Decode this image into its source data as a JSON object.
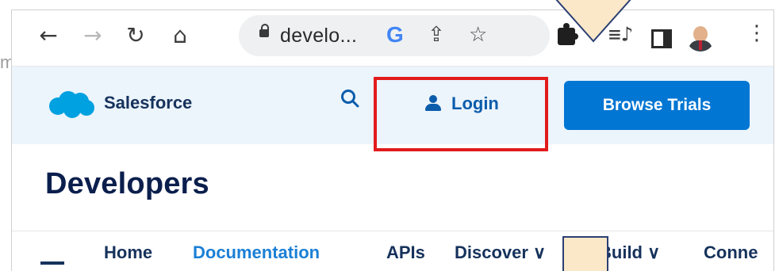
{
  "browser": {
    "back_icon": "arrow-left-icon",
    "forward_icon": "arrow-right-icon",
    "reload_icon": "reload-icon",
    "home_icon": "home-icon",
    "url": "develo...",
    "google_letter": "G",
    "share_icon": "share-icon",
    "bookmark_icon": "star-icon",
    "extensions_icon": "puzzle-icon",
    "media_icon": "media-queue-icon",
    "side_panel_icon": "side-panel-icon",
    "profile_icon": "avatar",
    "menu_icon": "kebab-menu-icon"
  },
  "stray_text": "m",
  "site": {
    "brand": "Salesforce",
    "login_label": "Login",
    "browse_trials_label": "Browse Trials",
    "page_title": "Developers",
    "nav": [
      "Home",
      "Documentation",
      "APIs",
      "Discover ∨",
      "Build ∨",
      "Conne"
    ],
    "active_nav": "Documentation"
  },
  "colors": {
    "header_bg": "#ecf4fc",
    "brand_blue": "#0176d3",
    "navy": "#16325c",
    "highlight_red": "#e21b1b",
    "callout_fill": "#fbe8c8",
    "callout_stroke": "#2b3f73"
  }
}
